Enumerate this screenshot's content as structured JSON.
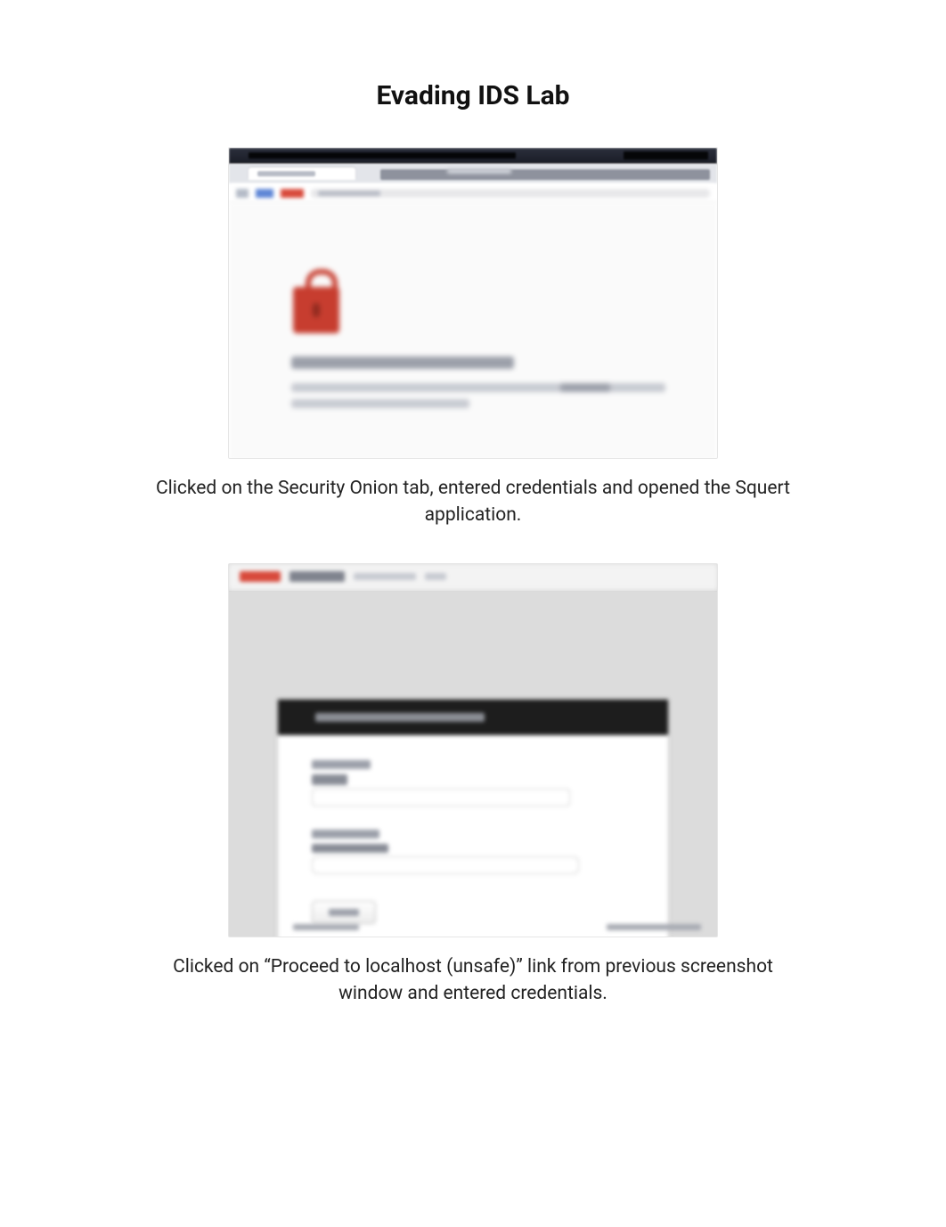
{
  "title": "Evading IDS Lab",
  "screenshot1": {
    "type": "browser-privacy-warning",
    "description": "Blurred browser window showing a red padlock warning icon and a 'connection not private' style message",
    "icon": "lock-warning-icon",
    "accent_color": "#c73d2f",
    "heading_text_unreadable": true,
    "body_text_unreadable": true
  },
  "caption1": "Clicked on the Security Onion tab, entered credentials and opened the Squert application.",
  "screenshot2": {
    "type": "login-panel",
    "description": "Blurred application login page with a dark header bar and username/password fields plus a submit button",
    "header_accent_color": "#d8493b",
    "panel_header_bg": "#1d1d1d",
    "fields": {
      "username_label_unreadable": true,
      "password_label_unreadable": true,
      "button_label_unreadable": true
    }
  },
  "caption2": "Clicked on “Proceed to localhost (unsafe)” link from previous screenshot window and entered credentials."
}
